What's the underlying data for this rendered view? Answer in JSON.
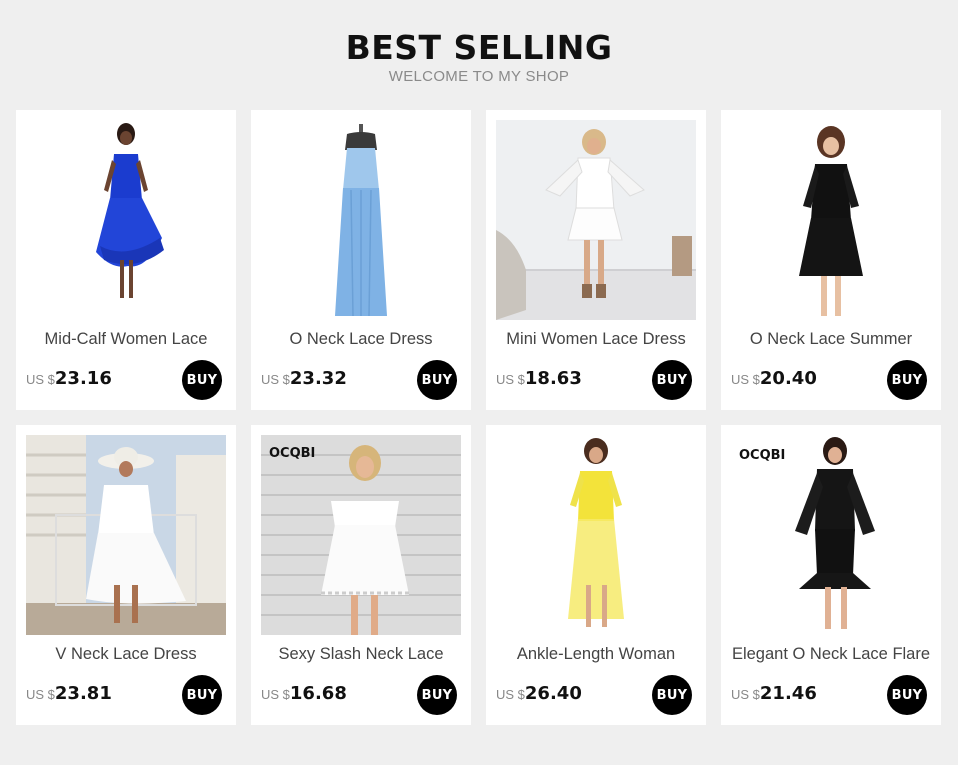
{
  "header": {
    "title": "BEST SELLING",
    "subtitle": "WELCOME TO MY SHOP"
  },
  "buy_label": "BUY",
  "products": [
    {
      "name": "Mid-Calf Women Lace",
      "currency": "US $",
      "price": "23.16"
    },
    {
      "name": "O Neck Lace Dress",
      "currency": "US $",
      "price": "23.32"
    },
    {
      "name": "Mini Women Lace Dress",
      "currency": "US $",
      "price": "18.63"
    },
    {
      "name": "O Neck Lace Summer",
      "currency": "US $",
      "price": "20.40"
    },
    {
      "name": "V Neck Lace Dress",
      "currency": "US $",
      "price": "23.81"
    },
    {
      "name": "Sexy Slash Neck Lace",
      "currency": "US $",
      "price": "16.68"
    },
    {
      "name": "Ankle-Length Woman",
      "currency": "US $",
      "price": "26.40"
    },
    {
      "name": "Elegant O Neck Lace Flare",
      "currency": "US $",
      "price": "21.46"
    }
  ],
  "image_brand": "OCQBI",
  "colors": {
    "background": "#efefef",
    "card": "#ffffff",
    "buy_button": "#000000"
  }
}
